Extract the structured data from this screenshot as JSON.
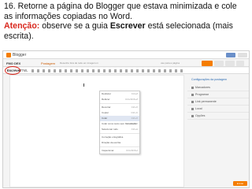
{
  "instructions": {
    "line1": "16. Retorne a página do Blogger que estava minimizada e cole",
    "line2": "as informações copiadas no Word.",
    "warn_label": "Atenção:",
    "line3_a": " observe se a guia ",
    "line3_b": "Escrever",
    "line3_c": " está selecionada (mais",
    "line4": "escrita)."
  },
  "blogger": {
    "brand": "Blogger",
    "blog_name": "FMO DEX",
    "section": "Postagem",
    "post_title": "Desenho fora de rede em imagem.m",
    "hint": "use para a página",
    "buttons": {
      "publish": "",
      "save": "",
      "preview": "",
      "close": ""
    }
  },
  "toolbar": {
    "write_tab": "Escrever",
    "html_tab": "HTML"
  },
  "context_menu": {
    "items": [
      {
        "label": "Desfazer",
        "shortcut": "Ctrl+Z"
      },
      {
        "label": "Refazer",
        "shortcut": "Ctrl+Shift+Z"
      },
      {
        "label": "Recortar",
        "shortcut": "Ctrl+X"
      },
      {
        "label": "Copiar",
        "shortcut": "Ctrl+C"
      },
      {
        "label": "Colar",
        "shortcut": "Ctrl+V"
      },
      {
        "label": "Colar como texto sem formatação",
        "shortcut": "Ctrl+Shift+V"
      },
      {
        "label": "Selecionar tudo",
        "shortcut": "Ctrl+A"
      },
      {
        "label": "Correção ortográfica",
        "shortcut": ""
      },
      {
        "label": "Direção da escrita",
        "shortcut": ""
      },
      {
        "label": "Inspecionar",
        "shortcut": "Ctrl+Shift+I"
      }
    ],
    "highlighted_index": 4
  },
  "sidebar": {
    "heading": "Configurações da postagem",
    "items": [
      "Marcadores",
      "Programar",
      "Link permanente",
      "Local",
      "Opções"
    ],
    "help_button": "Enviar feedback"
  }
}
